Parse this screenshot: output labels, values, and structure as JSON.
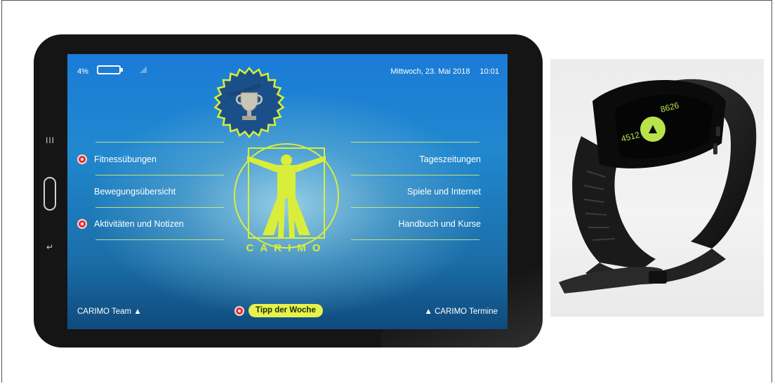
{
  "status": {
    "battery_pct": "4%",
    "date": "Mittwoch, 23. Mai 2018",
    "time": "10:01"
  },
  "badge": {
    "text": "Diese Woche"
  },
  "menu": {
    "left": [
      {
        "label": "Fitnessübungen",
        "has_dot": true
      },
      {
        "label": "Bewegungsübersicht",
        "has_dot": false
      },
      {
        "label": "Aktivitäten und Notizen",
        "has_dot": true
      }
    ],
    "right": [
      {
        "label": "Tageszeitungen"
      },
      {
        "label": "Spiele und Internet"
      },
      {
        "label": "Handbuch und Kurse"
      }
    ]
  },
  "logo": {
    "text": "CARIMO"
  },
  "footer": {
    "left": "CARIMO Team",
    "tip": "Tipp der Woche",
    "right": "CARIMO Termine"
  },
  "wristband": {
    "screen_top_value": "8626",
    "screen_bottom_value": "4512"
  },
  "colors": {
    "accent": "#d8ee3a",
    "notification": "#e82b2b",
    "screen_blue": "#1a7bd6"
  }
}
